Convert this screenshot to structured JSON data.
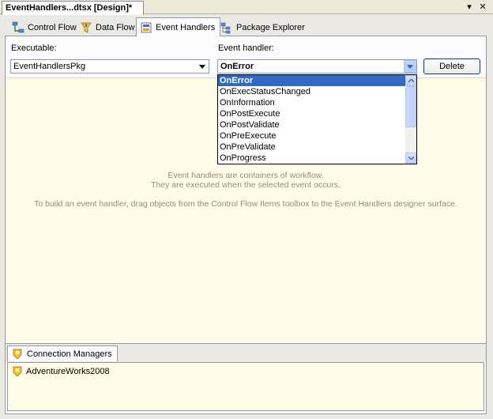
{
  "document_tab": {
    "title": "EventHandlers...dtsx [Design]*"
  },
  "window_controls": {
    "dropdown_glyph": "▾",
    "close_glyph": "✕"
  },
  "designer_tabs": [
    {
      "label": "Control Flow",
      "icon": "control-flow-icon",
      "active": false
    },
    {
      "label": "Data Flow",
      "icon": "data-flow-icon",
      "active": false
    },
    {
      "label": "Event Handlers",
      "icon": "event-handlers-icon",
      "active": true
    },
    {
      "label": "Package Explorer",
      "icon": "package-explorer-icon",
      "active": false
    }
  ],
  "toolbar": {
    "executable_label": "Executable:",
    "executable_value": "EventHandlersPkg",
    "event_handler_label": "Event handler:",
    "event_handler_value": "OnError",
    "delete_label": "Delete"
  },
  "event_handler_options": [
    "OnError",
    "OnExecStatusChanged",
    "OnInformation",
    "OnPostExecute",
    "OnPostValidate",
    "OnPreExecute",
    "OnPreValidate",
    "OnProgress"
  ],
  "selected_option_index": 0,
  "surface_messages": {
    "line1": "Event handlers are containers of workflow.",
    "line2": "They are executed when the selected event occurs.",
    "line3": "To build an event handler, drag objects from the Control Flow Items toolbox to the Event Handlers designer surface."
  },
  "connection_managers": {
    "tab_label": "Connection Managers",
    "items": [
      "AdventureWorks2008"
    ]
  },
  "colors": {
    "surface_background": "#fffce8",
    "selection_highlight": "#316ac5",
    "message_text": "#8e8d85"
  }
}
